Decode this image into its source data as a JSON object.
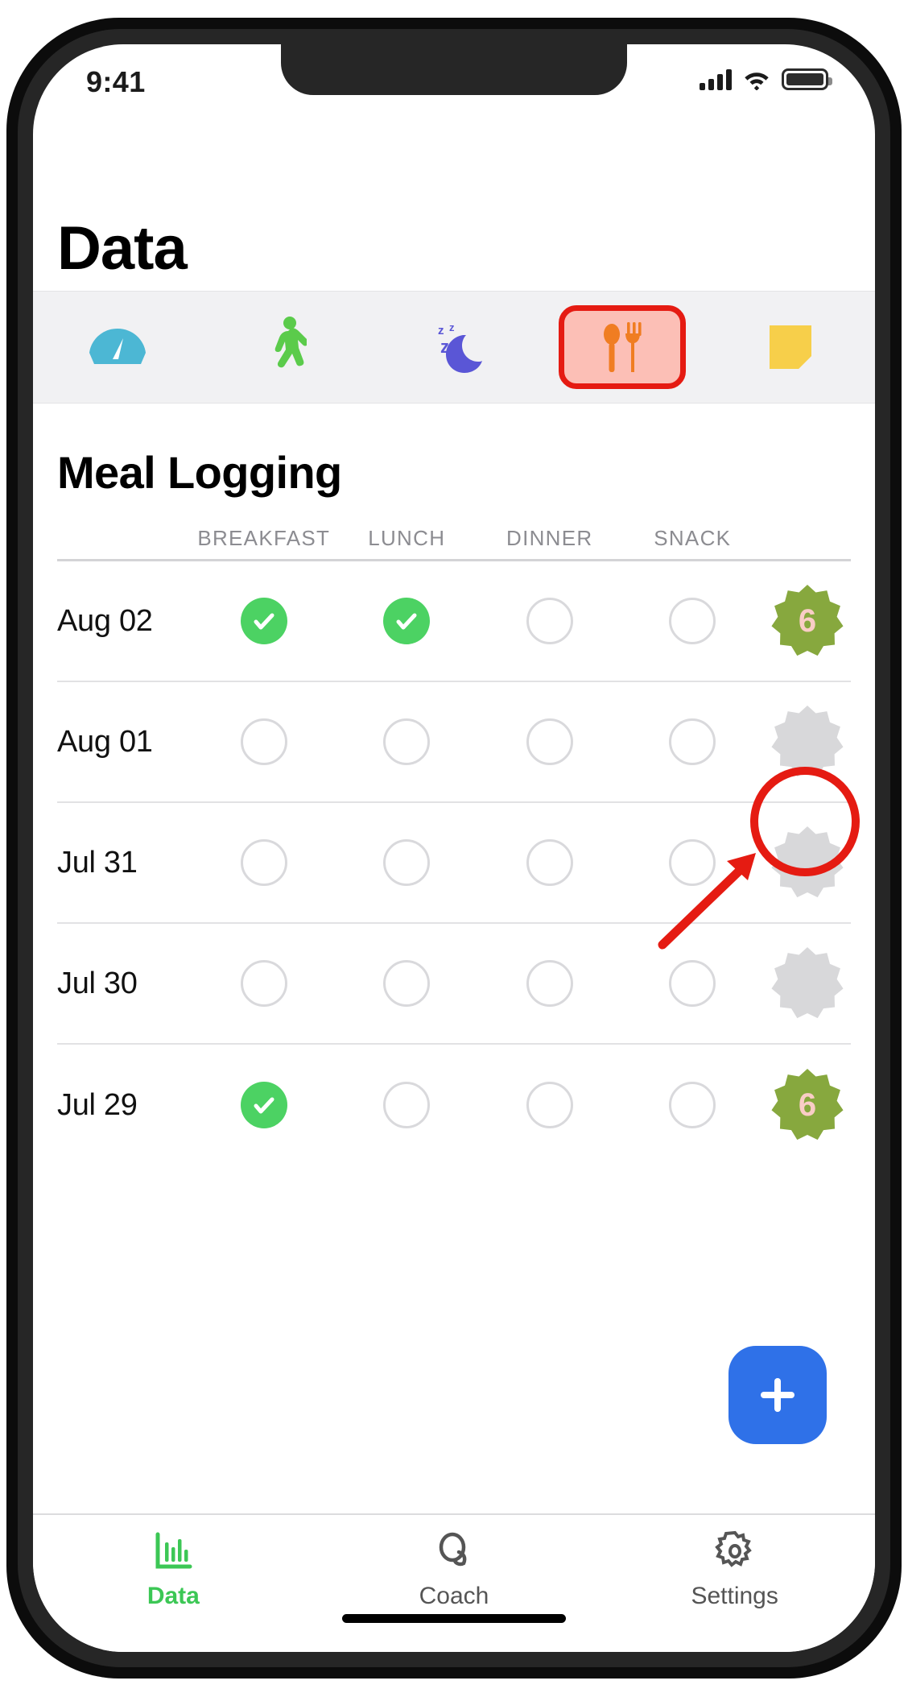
{
  "status_bar": {
    "time": "9:41",
    "signal_icon": "cellular-signal-icon",
    "wifi_icon": "wifi-icon",
    "battery_icon": "battery-icon"
  },
  "header": {
    "title": "Data"
  },
  "category_tabs": [
    {
      "id": "weight",
      "icon": "scale-gauge-icon",
      "label": "Weight",
      "selected": false,
      "color": "#4cb7d4"
    },
    {
      "id": "steps",
      "icon": "walking-person-icon",
      "label": "Activity",
      "selected": false,
      "color": "#5bcb4b"
    },
    {
      "id": "sleep",
      "icon": "sleep-moon-icon",
      "label": "Sleep",
      "selected": false,
      "color": "#5a56d6"
    },
    {
      "id": "meals",
      "icon": "fork-spoon-icon",
      "label": "Meal Logging",
      "selected": true,
      "color": "#f07d22"
    },
    {
      "id": "notes",
      "icon": "sticky-note-icon",
      "label": "Notes",
      "selected": false,
      "color": "#f7cf4a"
    }
  ],
  "main": {
    "section_title": "Meal Logging",
    "columns": [
      "BREAKFAST",
      "LUNCH",
      "DINNER",
      "SNACK"
    ],
    "rows": [
      {
        "date": "Aug 02",
        "meals": [
          true,
          true,
          false,
          false
        ],
        "score": "6",
        "score_state": "filled"
      },
      {
        "date": "Aug 01",
        "meals": [
          false,
          false,
          false,
          false
        ],
        "score": "",
        "score_state": "empty"
      },
      {
        "date": "Jul 31",
        "meals": [
          false,
          false,
          false,
          false
        ],
        "score": "",
        "score_state": "empty"
      },
      {
        "date": "Jul 30",
        "meals": [
          false,
          false,
          false,
          false
        ],
        "score": "",
        "score_state": "empty"
      },
      {
        "date": "Jul 29",
        "meals": [
          true,
          false,
          false,
          false
        ],
        "score": "6",
        "score_state": "filled"
      }
    ]
  },
  "fab": {
    "icon": "plus-icon",
    "label": "+"
  },
  "annotation": {
    "highlight_color": "#e51b12",
    "ring_target": "score-badge-aug-02",
    "arrow": "pointer-arrow"
  },
  "bottom_tabs": [
    {
      "id": "data",
      "label": "Data",
      "icon": "bar-chart-icon",
      "active": true
    },
    {
      "id": "coach",
      "label": "Coach",
      "icon": "chat-bubble-icon",
      "active": false
    },
    {
      "id": "settings",
      "label": "Settings",
      "icon": "gear-icon",
      "active": false
    }
  ],
  "colors": {
    "accent_green": "#4cd263",
    "tab_active_green": "#3cc755",
    "fab_blue": "#2f71e8",
    "annotation_red": "#e51b12",
    "highlight_fill": "#fcbfb6",
    "badge_green": "#87a83e",
    "badge_empty": "#d8d8da"
  }
}
